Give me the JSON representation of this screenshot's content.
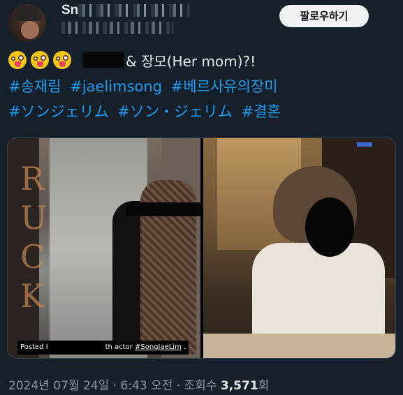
{
  "header": {
    "display_name": "Sn",
    "follow_label": "팔로우하기"
  },
  "tweet": {
    "text_suffix": "& 장모(Her mom)?!",
    "hashtags_line1": [
      "#송재림",
      "#jaelimsong",
      "#베르사유의장미"
    ],
    "hashtags_line2": [
      "#ソンジェリム",
      "#ソン・ジェリム",
      "#결혼"
    ]
  },
  "media": {
    "left_caption_prefix": "Posted I",
    "left_caption_mid": "th actor ",
    "left_caption_tag": "#SongJaeLim",
    "left_caption_end": " ."
  },
  "footer": {
    "date": "2024년 07월 24일",
    "sep1": " · ",
    "time": "6:43 오전",
    "sep2": " · ",
    "views_label": "조회수 ",
    "views_count": "3,571",
    "views_unit": "회"
  },
  "icons": {
    "emoji": "zany-face-emoji"
  }
}
